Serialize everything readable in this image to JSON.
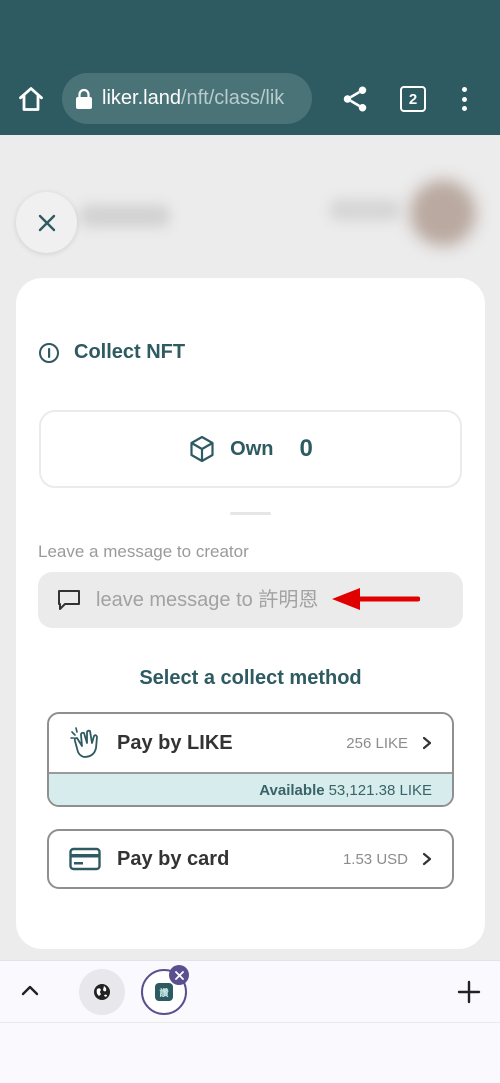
{
  "browser": {
    "url_host": "liker.land",
    "url_path": "/nft/class/lik",
    "tab_count": "2"
  },
  "dialog": {
    "title": "Collect NFT",
    "own_label": "Own",
    "own_count": "0",
    "message_label": "Leave a message to creator",
    "message_placeholder": "leave message to 許明恩",
    "collect_heading": "Select a collect method",
    "pay_like": {
      "label": "Pay by LIKE",
      "price": "256 LIKE",
      "available_label": "Available",
      "available_value": "53,121.38 LIKE"
    },
    "pay_card": {
      "label": "Pay by card",
      "price": "1.53 USD"
    }
  },
  "bottom_bar": {
    "tab_favicon_text": "讚"
  },
  "colors": {
    "toolbar": "#2e5a61",
    "accent_text": "#2e5a61",
    "annotation_arrow": "#e00000"
  },
  "icons": [
    "home-icon",
    "lock-icon",
    "share-icon",
    "more-vert-icon",
    "close-icon",
    "info-icon",
    "cube-icon",
    "chat-icon",
    "clap-icon",
    "credit-card-icon",
    "chevron-right-icon",
    "chevron-up-icon",
    "globe-icon",
    "plus-icon"
  ]
}
